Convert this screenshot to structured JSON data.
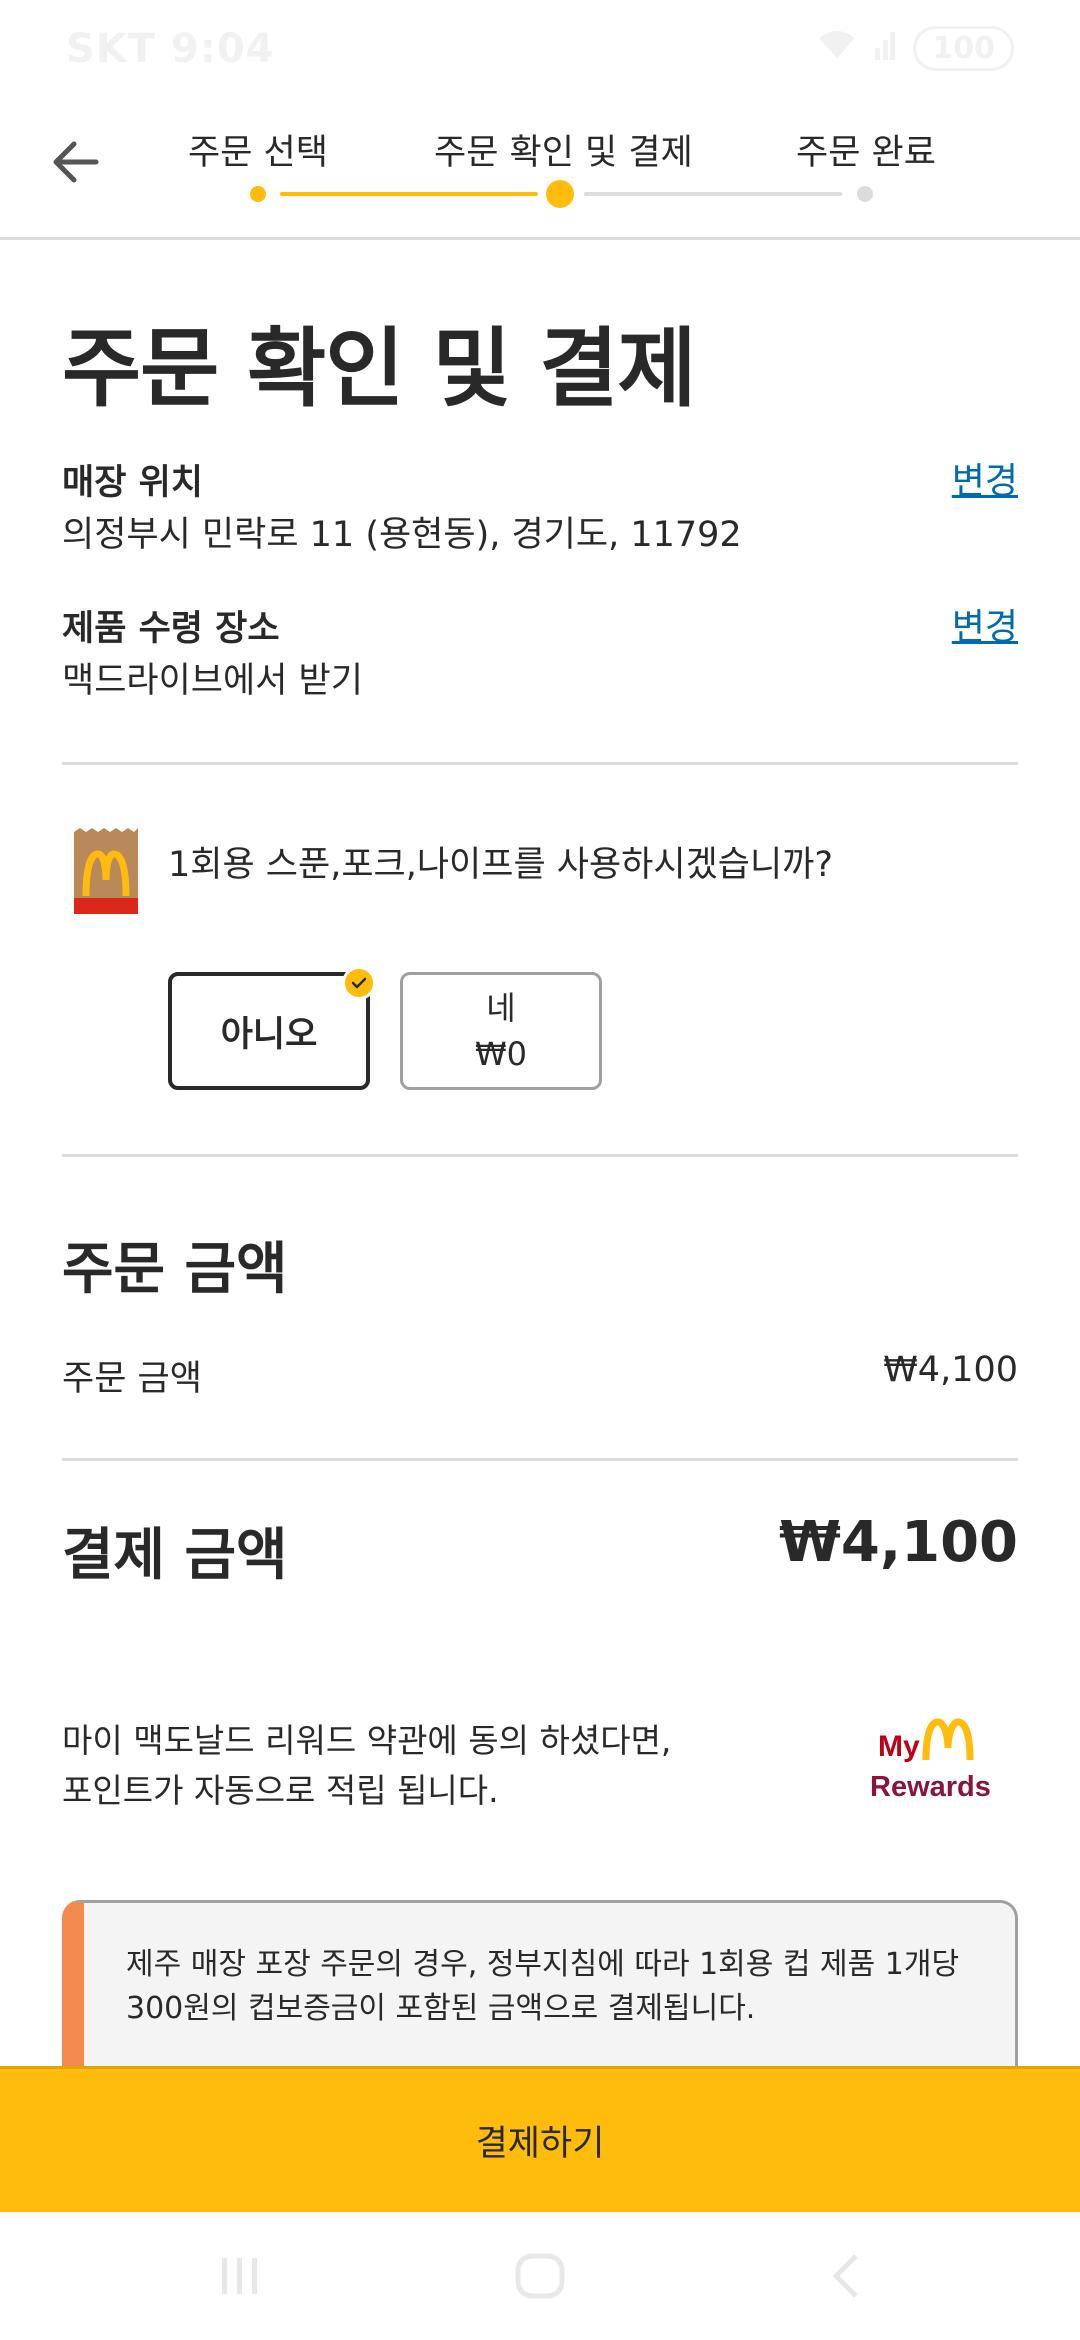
{
  "status_bar": {
    "time": "SKT 9:04",
    "battery": "100"
  },
  "stepper": {
    "steps": [
      "주문 선택",
      "주문 확인 및 결제",
      "주문 완료"
    ],
    "current_index": 1
  },
  "page": {
    "title": "주문 확인 및 결제"
  },
  "store": {
    "label": "매장 위치",
    "value": "의정부시 민락로 11 (용현동), 경기도, 11792",
    "change_label": "변경"
  },
  "pickup": {
    "label": "제품 수령 장소",
    "value": "맥드라이브에서 받기",
    "change_label": "변경"
  },
  "cutlery": {
    "question": "1회용 스푼,포크,나이프를 사용하시겠습니까?",
    "options": [
      {
        "label": "아니오",
        "price": "",
        "selected": true
      },
      {
        "label": "네",
        "price": "₩0",
        "selected": false
      }
    ]
  },
  "order_amount": {
    "section_title": "주문 금액",
    "row_label": "주문 금액",
    "row_value": "₩4,100"
  },
  "payment": {
    "label": "결제 금액",
    "value": "₩4,100"
  },
  "rewards": {
    "line1": "마이 맥도날드 리워드 약관에 동의 하셨다면,",
    "line2": "포인트가 자동으로 적립 됩니다.",
    "logo_my": "My",
    "logo_rewards": "Rewards"
  },
  "notice": {
    "text": "제주 매장 포장 주문의 경우, 정부지침에 따라 1회용 컵 제품 1개당 300원의 컵보증금이 포함된 금액으로 결제됩니다."
  },
  "pay_button": {
    "label": "결제하기"
  },
  "colors": {
    "accent_yellow": "#ffbc0d",
    "link_blue": "#006bae",
    "notice_orange": "#f38b4e",
    "text_dark": "#292929"
  }
}
